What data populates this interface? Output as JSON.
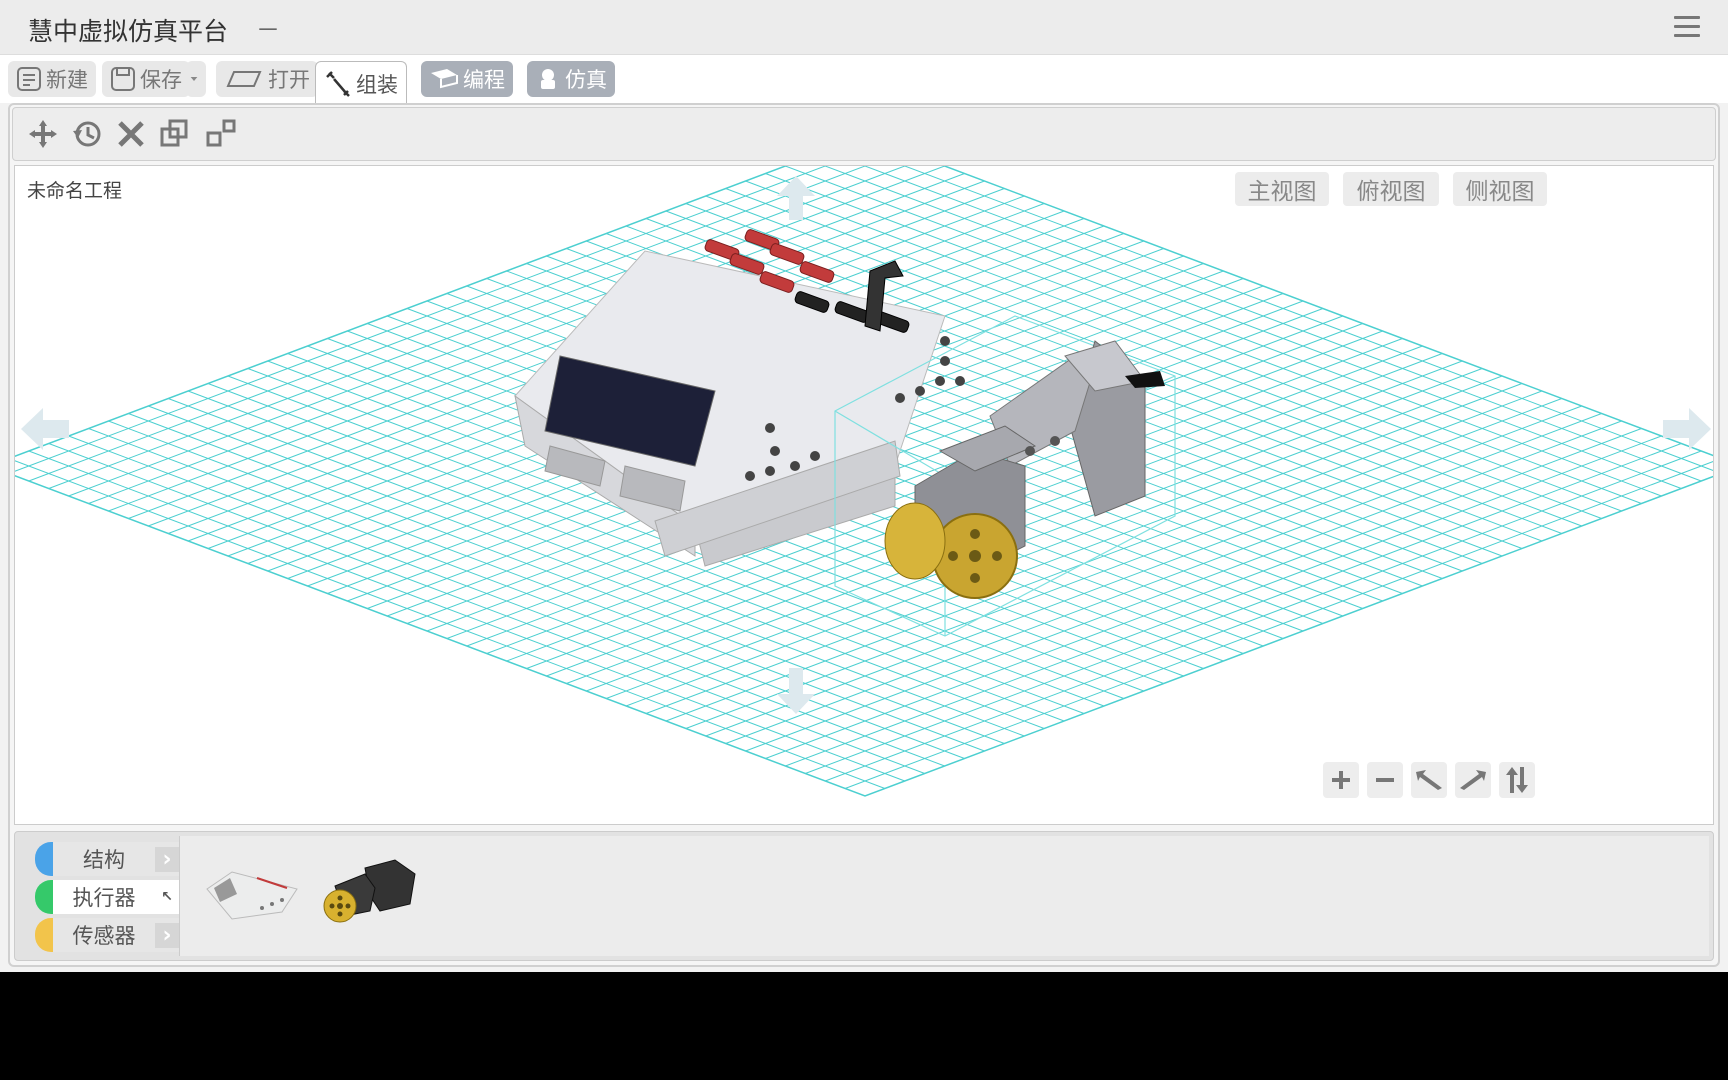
{
  "app": {
    "title": "慧中虚拟仿真平台",
    "title_suffix": "－"
  },
  "toolbar": {
    "new_label": "新建",
    "save_label": "保存",
    "open_label": "打开",
    "assemble_label": "组装",
    "program_label": "编程",
    "simulate_label": "仿真"
  },
  "viewport": {
    "project_name": "未命名工程",
    "views": {
      "front": "主视图",
      "top": "俯视图",
      "side": "侧视图"
    }
  },
  "palette": {
    "categories": [
      {
        "label": "结构",
        "color": "#4aa3e8"
      },
      {
        "label": "执行器",
        "color": "#35c96a"
      },
      {
        "label": "传感器",
        "color": "#f2c44b"
      }
    ]
  },
  "colors": {
    "grid": "#4ccfd0",
    "accent_dark_button": "#a9afb8"
  }
}
